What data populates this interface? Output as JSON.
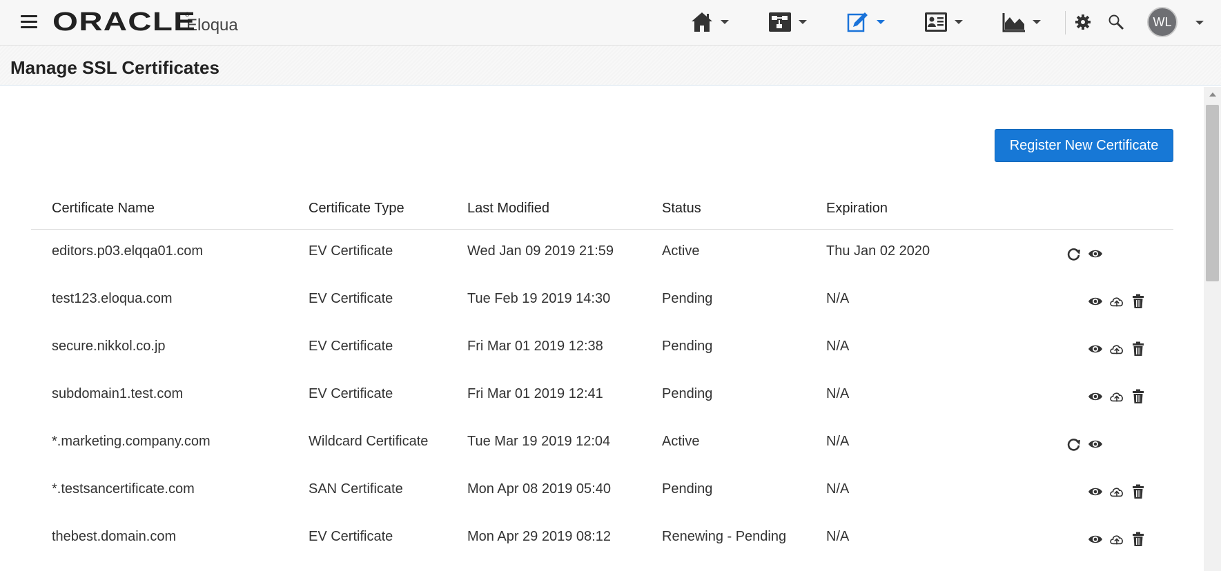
{
  "app": {
    "brand": "ORACLE",
    "brand_mark": "®",
    "product": "Eloqua"
  },
  "topbar": {
    "nav_icons": [
      "home-icon",
      "orchestration-icon",
      "assets-icon",
      "contacts-icon",
      "analytics-icon"
    ],
    "settings_icon": "gear-icon",
    "search_icon": "search-icon",
    "user_initials": "WL",
    "accent": "#1a73d9"
  },
  "page": {
    "title": "Manage SSL Certificates",
    "register_button": "Register New Certificate"
  },
  "table": {
    "headers": [
      "Certificate Name",
      "Certificate Type",
      "Last Modified",
      "Status",
      "Expiration"
    ],
    "rows": [
      {
        "name": "editors.p03.elqqa01.com",
        "type": "EV Certificate",
        "modified": "Wed Jan 09 2019 21:59",
        "status": "Active",
        "expiration": "Thu Jan 02 2020"
      },
      {
        "name": "test123.eloqua.com",
        "type": "EV Certificate",
        "modified": "Tue Feb 19 2019 14:30",
        "status": "Pending",
        "expiration": "N/A"
      },
      {
        "name": "secure.nikkol.co.jp",
        "type": "EV Certificate",
        "modified": "Fri Mar 01 2019 12:38",
        "status": "Pending",
        "expiration": "N/A"
      },
      {
        "name": "subdomain1.test.com",
        "type": "EV Certificate",
        "modified": "Fri Mar 01 2019 12:41",
        "status": "Pending",
        "expiration": "N/A"
      },
      {
        "name": "*.marketing.company.com",
        "type": "Wildcard Certificate",
        "modified": "Tue Mar 19 2019 12:04",
        "status": "Active",
        "expiration": "N/A"
      },
      {
        "name": "*.testsancertificate.com",
        "type": "SAN Certificate",
        "modified": "Mon Apr 08 2019 05:40",
        "status": "Pending",
        "expiration": "N/A"
      },
      {
        "name": "thebest.domain.com",
        "type": "EV Certificate",
        "modified": "Mon Apr 29 2019 08:12",
        "status": "Renewing - Pending",
        "expiration": "N/A"
      }
    ],
    "active_actions": [
      "renew-icon",
      "view-icon"
    ],
    "pending_actions": [
      "view-icon",
      "upload-icon",
      "delete-icon"
    ]
  }
}
